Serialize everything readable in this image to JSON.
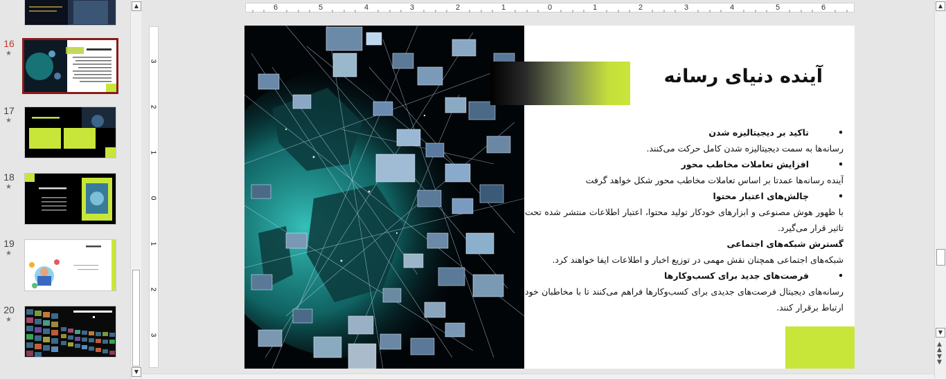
{
  "thumbnails": [
    {
      "number": "",
      "star": ""
    },
    {
      "number": "16",
      "star": "★",
      "title": "آینده دنیای رسانه"
    },
    {
      "number": "17",
      "star": "★",
      "title": "مزایای آینده دنیای رسانه"
    },
    {
      "number": "18",
      "star": "★",
      "title": "معایب آینده دنیای رسانه"
    },
    {
      "number": "19",
      "star": "★",
      "title": "منابع"
    },
    {
      "number": "20",
      "star": "★",
      "title": "با تشکر از توجه شما"
    }
  ],
  "ruler": {
    "horizontal": [
      "6",
      "5",
      "4",
      "3",
      "2",
      "1",
      "0",
      "1",
      "2",
      "3",
      "4",
      "5",
      "6"
    ],
    "vertical": [
      "3",
      "2",
      "1",
      "0",
      "1",
      "2",
      "3"
    ]
  },
  "slide": {
    "title": "آینده دنیای رسانه",
    "bullet1_heading": "تاکید بر دیجیتالیزه شدن",
    "bullet1_text": "رسانه‌ها به سمت دیجیتالیزه شدن کامل حرکت می‌کنند.",
    "bullet2_heading": "افزایش تعاملات مخاطب محور",
    "bullet2_text": "آینده رسانه‌ها عمدتا بر اساس تعاملات مخاطب محور شکل خواهد گرفت",
    "bullet3_heading": "چالش‌های اعتبار محتوا",
    "bullet3_text": "با ظهور هوش مصنوعی و ابزارهای خودکار تولید محتوا، اعتبار اطلاعات منتشر شده تحت تاثیر قرار می‌گیرد.",
    "bullet4_heading": "گسترش شبکه‌های اجتماعی",
    "bullet4_text": "شبکه‌های اجتماعی همچنان نقش مهمی در توزیع اخبار و اطلاعات ایفا خواهند کرد.",
    "bullet5_heading": "فرصت‌های جدید برای کسب‌وکارها",
    "bullet5_text": "رسانه‌های دیجیتال فرصت‌های جدیدی برای کسب‌وکارها فراهم می‌کنند تا با مخاطبان خود ارتباط برقرار کنند."
  },
  "colors": {
    "accent": "#c8e63a",
    "active_border": "#8b1a1a",
    "active_number": "#c0392b"
  }
}
